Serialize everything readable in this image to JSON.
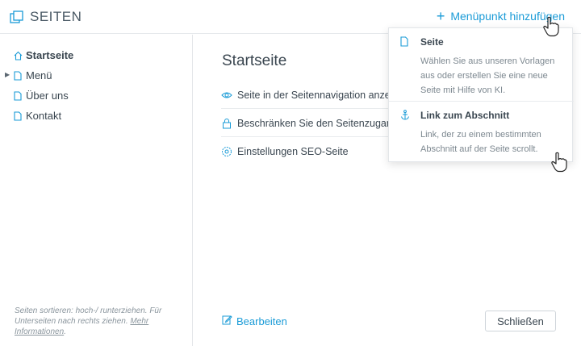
{
  "header": {
    "title": "SEITEN",
    "add_label": "Menüpunkt hinzufügen",
    "add_icon": "plus-icon",
    "brand_icon": "pages-icon"
  },
  "sidebar": {
    "items": [
      {
        "label": "Startseite",
        "icon": "home-icon",
        "active": true
      },
      {
        "label": "Menü",
        "icon": "page-icon",
        "has_children": true
      },
      {
        "label": "Über uns",
        "icon": "page-icon"
      },
      {
        "label": "Kontakt",
        "icon": "page-icon"
      }
    ],
    "note_text": "Seiten sortieren: hoch-/ runterziehen. Für Unterseiten nach rechts ziehen.",
    "note_link": "Mehr Informationen",
    "note_end": "."
  },
  "main": {
    "title": "Startseite",
    "options": [
      {
        "label": "Seite in der Seitennavigation anzeigen",
        "icon": "eye-icon"
      },
      {
        "label": "Beschränken Sie den Seitenzugang",
        "icon": "lock-icon"
      },
      {
        "label": "Einstellungen SEO-Seite",
        "icon": "gear-icon"
      }
    ],
    "edit_label": "Bearbeiten",
    "close_label": "Schließen"
  },
  "dropdown": {
    "items": [
      {
        "title": "Seite",
        "description": "Wählen Sie aus unseren Vorlagen aus oder erstellen Sie eine neue Seite mit Hilfe von KI.",
        "icon": "page-icon"
      },
      {
        "title": "Link zum Abschnitt",
        "description": "Link, der zu einem bestimmten Abschnitt auf der Seite scrollt.",
        "icon": "anchor-icon"
      }
    ]
  },
  "colors": {
    "accent": "#1a9bd7",
    "text": "#3a4650",
    "muted": "#7d8890",
    "border": "#e3e6e9"
  }
}
